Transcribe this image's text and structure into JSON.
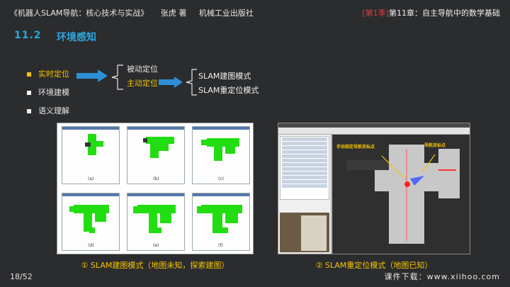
{
  "header": {
    "book_title": "《机器人SLAM导航：核心技术与实战》",
    "author": "张虎 著",
    "publisher": "机械工业出版社",
    "season": "[第1季]",
    "chapter": "第11章：自主导航中的数学基础"
  },
  "section": {
    "number": "11.2",
    "title": "环境感知"
  },
  "bullets": [
    {
      "label": "实时定位"
    },
    {
      "label": "环境建模"
    },
    {
      "label": "语义理解"
    }
  ],
  "localization": {
    "passive": "被动定位",
    "active": "主动定位",
    "modes": [
      "SLAM建图模式",
      "SLAM重定位模式"
    ]
  },
  "figures": {
    "left_panels": [
      "(a)",
      "(b)",
      "(c)",
      "(d)",
      "(e)",
      "(f)"
    ],
    "right_annotations": {
      "manual": "手动指定导航目标点",
      "goal": "导航目标点"
    },
    "caption_left": "① SLAM建图模式（地图未知，探索建图）",
    "caption_right": "② SLAM重定位模式（地图已知）"
  },
  "footer": {
    "page": "18/52",
    "download": "课件下载：www.xiihoo.com"
  },
  "colors": {
    "accent_blue": "#2aa8e0",
    "highlight_yellow": "#f5c400",
    "season_red": "#e03b3b",
    "map_green": "#22dd11"
  }
}
